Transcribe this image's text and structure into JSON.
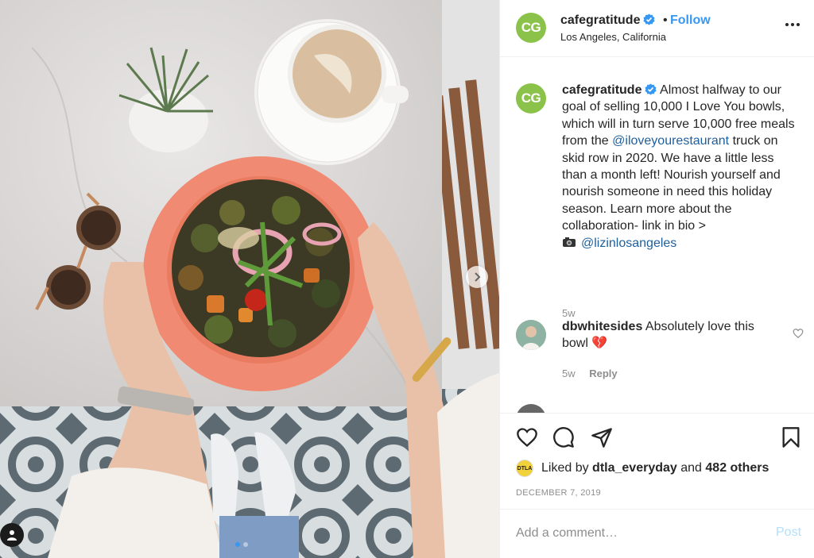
{
  "post": {
    "username": "cafegratitude",
    "avatar_initials": "CG",
    "separator": "•",
    "follow_label": "Follow",
    "location": "Los Angeles, California",
    "more_icon": "more-horizontal-icon"
  },
  "caption": {
    "username": "cafegratitude",
    "text_1": "Almost halfway to our goal of selling 10,000 I Love You bowls, which will in turn serve 10,000 free meals from the",
    "mention_1": "@iloveyourestaurant",
    "text_2": "truck on skid row in 2020. We have a little less than a month left! Nourish yourself and nourish someone in need this holiday season. Learn more about the collaboration- link in bio >",
    "mention_2": "@lizinlosangeles",
    "time": "5w"
  },
  "comments": [
    {
      "username": "dbwhitesides",
      "text": "Absolutely love this bowl",
      "emoji": "💔",
      "time": "5w",
      "reply_label": "Reply"
    }
  ],
  "likes": {
    "prefix": "Liked by",
    "user": "dtla_everyday",
    "conjunction": "and",
    "others": "482 others",
    "avatar_text": "DTLA"
  },
  "date": "DECEMBER 7, 2019",
  "add_comment": {
    "placeholder": "Add a comment…",
    "post_label": "Post"
  },
  "colors": {
    "accent_blue": "#3897f0",
    "verified_blue": "#3897f0",
    "avatar_green": "#8bc34a",
    "bowl_coral": "#f08a72"
  }
}
